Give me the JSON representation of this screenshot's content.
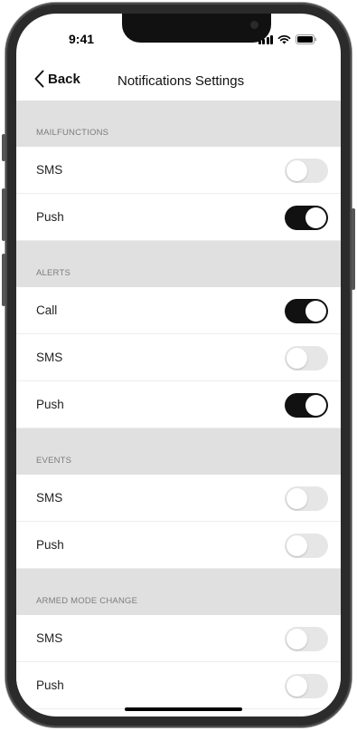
{
  "status_bar": {
    "time": "9:41"
  },
  "nav": {
    "back_label": "Back",
    "title": "Notifications Settings"
  },
  "sections": [
    {
      "header": "MAILFUNCTIONS",
      "rows": [
        {
          "label": "SMS",
          "enabled": false
        },
        {
          "label": "Push",
          "enabled": true
        }
      ]
    },
    {
      "header": "ALERTS",
      "rows": [
        {
          "label": "Call",
          "enabled": true
        },
        {
          "label": "SMS",
          "enabled": false
        },
        {
          "label": "Push",
          "enabled": true
        }
      ]
    },
    {
      "header": "EVENTS",
      "rows": [
        {
          "label": "SMS",
          "enabled": false
        },
        {
          "label": "Push",
          "enabled": false
        }
      ]
    },
    {
      "header": "ARMED MODE CHANGE",
      "rows": [
        {
          "label": "SMS",
          "enabled": false
        },
        {
          "label": "Push",
          "enabled": false
        }
      ]
    }
  ],
  "colors": {
    "toggle_on": "#111111",
    "toggle_off": "#e6e6e6",
    "section_bg": "#e0e0e0"
  }
}
